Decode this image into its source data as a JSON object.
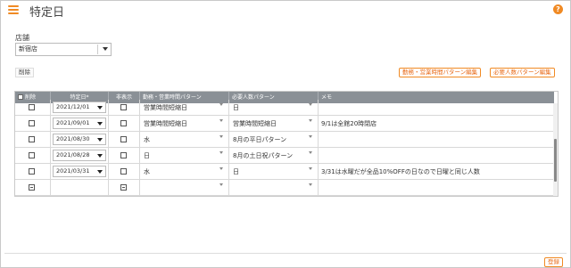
{
  "header": {
    "title": "特定日",
    "menu_icon": "hamburger-menu-icon",
    "help_icon": "question-icon",
    "help_glyph": "?"
  },
  "store": {
    "label": "店舗",
    "selected": "新宿店"
  },
  "toolbar": {
    "delete_label": "削除",
    "work_pattern_label": "勤務・営業時間パターン編集",
    "staff_pattern_label": "必要人数パターン編集"
  },
  "grid": {
    "columns": [
      "削除",
      "特定日*",
      "非表示",
      "勤務・営業時間パターン",
      "必要人数パターン",
      "メモ"
    ],
    "rows": [
      {
        "date": "2021/12/01",
        "work_pattern": "営業時間短縮日",
        "staff_pattern": "日",
        "memo": ""
      },
      {
        "date": "2021/09/01",
        "work_pattern": "営業時間短縮日",
        "staff_pattern": "営業時間短縮日",
        "memo": "9/1は全館20時閉店"
      },
      {
        "date": "2021/08/30",
        "work_pattern": "水",
        "staff_pattern": "8月の平日パターン",
        "memo": ""
      },
      {
        "date": "2021/08/28",
        "work_pattern": "日",
        "staff_pattern": "8月の土日祝パターン",
        "memo": ""
      },
      {
        "date": "2021/03/31",
        "work_pattern": "水",
        "staff_pattern": "日",
        "memo": "3/31は水曜だが全品10%OFFの日なので日曜と同じ人数"
      },
      {
        "date": "",
        "work_pattern": "",
        "staff_pattern": "",
        "memo": ""
      }
    ]
  },
  "footer": {
    "register_label": "登録"
  },
  "colors": {
    "accent": "#f08a24",
    "header_bg": "#8a9096"
  }
}
